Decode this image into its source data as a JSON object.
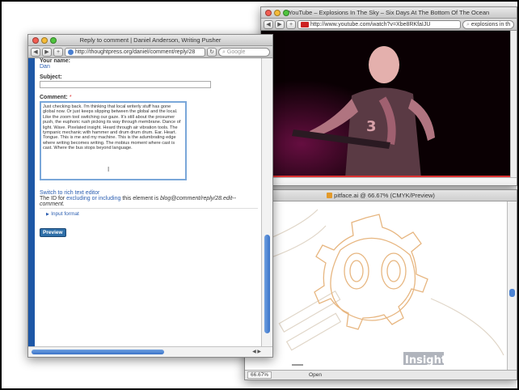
{
  "youtube_window": {
    "title": "YouTube – Explosions In The Sky – Six Days At The Bottom Of The Ocean",
    "url": "http://www.youtube.com/watch?v=Xbe8RKfaIJU",
    "search": "explosions in th"
  },
  "illustrator_window": {
    "title": "pitface.ai @ 66.67% (CMYK/Preview)",
    "zoom": "66.67%",
    "status": "Open",
    "art_text": "Insights"
  },
  "reply_window": {
    "title": "Reply to comment | Daniel Anderson, Writing Pusher",
    "url": "http://thoughtpress.org/daniel/comment/reply/28",
    "search_placeholder": "Google",
    "name_label": "Your name:",
    "name_value": "Dan",
    "subject_label": "Subject:",
    "comment_label": "Comment:",
    "comment_required": "*",
    "comment_text": "Just checking back. I'm thinking that local writerly stuff has gone global now. Or just keeps slipping between the global and the local. Like the zoom tool switching our gaze. It's still about the prosumer push, the euphoric rush picking its way through membrane. Dance of light. Wave. Pixelated insight. Heard through air vibration tools. The tympanic mechanic with hammer and drum drum drum. Ear. Heart. Tongue. This is me and my machine. This is the adumbrating edge where writing becomes writing. The mobius moment where cast is cast. Where the bus stops beyond language.",
    "rich_text_link": "Switch to rich text editor",
    "id_prefix": "The ID for",
    "id_link": "excluding or including",
    "id_mid": "this element is",
    "id_value": "blog@comment/reply/28.edit--comment.",
    "input_format": "Input format",
    "preview_button": "Preview"
  },
  "colors": {
    "accent_blue": "#1d57a6",
    "link_blue": "#2a5db0",
    "art_orange": "#e7b680"
  }
}
